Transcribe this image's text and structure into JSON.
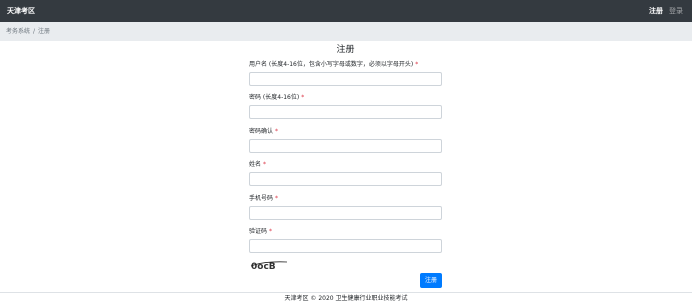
{
  "navbar": {
    "brand": "天津考区",
    "links": [
      {
        "label": "注册",
        "active": true
      },
      {
        "label": "登录",
        "active": false
      }
    ]
  },
  "breadcrumb": {
    "items": [
      "考务系统",
      "注册"
    ],
    "separator": "/"
  },
  "form": {
    "title": "注册",
    "fields": [
      {
        "label": "用户名 (长度4-16位，包含小写字母或数字，必须以字母开头)",
        "required": true,
        "value": ""
      },
      {
        "label": "密码 (长度4-16位)",
        "required": true,
        "value": ""
      },
      {
        "label": "密码确认",
        "required": true,
        "value": ""
      },
      {
        "label": "姓名",
        "required": true,
        "value": ""
      },
      {
        "label": "手机号码",
        "required": true,
        "value": ""
      },
      {
        "label": "验证码",
        "required": true,
        "value": ""
      }
    ],
    "required_mark": "*",
    "captcha_text": "0ocB",
    "submit_label": "注册"
  },
  "footer": {
    "text": "天津考区 © 2020 卫生健康行业职业技能考试"
  },
  "colors": {
    "navbar_bg": "#343a40",
    "breadcrumb_bg": "#e9ecef",
    "primary": "#007bff",
    "required": "#dc3545"
  }
}
